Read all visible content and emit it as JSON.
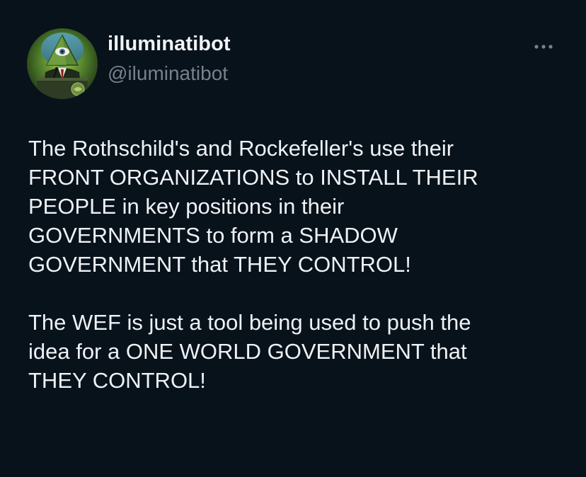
{
  "author": {
    "display_name": "illuminatibot",
    "handle": "@iluminatibot",
    "avatar_icon": "illuminati-eye-pyramid-avatar"
  },
  "more_icon": "more-horizontal-icon",
  "tweet": {
    "paragraph1": [
      "The Rothschild's and Rockefeller's use their",
      "FRONT ORGANIZATIONS to INSTALL THEIR",
      "PEOPLE in key positions in their",
      "GOVERNMENTS to form a SHADOW",
      "GOVERNMENT that THEY CONTROL!"
    ],
    "paragraph2": [
      "The WEF is just a tool being used to push the",
      "idea for a ONE WORLD GOVERNMENT that",
      "THEY CONTROL!"
    ]
  },
  "colors": {
    "background": "#08121b",
    "text": "#eef2f5",
    "secondary": "#75818d",
    "accent": "#1d9bf0"
  }
}
